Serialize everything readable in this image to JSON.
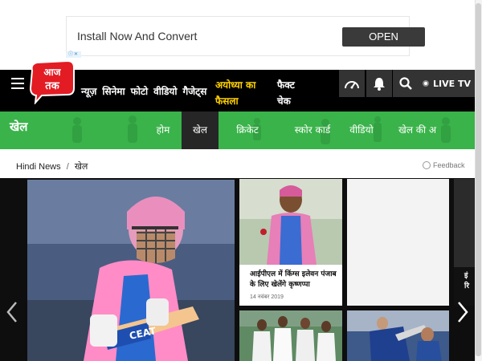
{
  "ad": {
    "text": "Install Now And Convert",
    "button_label": "OPEN",
    "ad_marker": "ⓘ✕"
  },
  "header": {
    "logo_text": "आज तक",
    "nav_items": [
      "न्यूज़",
      "सिनेमा",
      "फोटो",
      "वीडियो",
      "गैजेट्स"
    ],
    "highlight_line1": "अयोध्या का",
    "highlight_line2": "फैसला",
    "fact_line1": "फैक्ट",
    "fact_line2": "चेक",
    "live_label": "LIVE TV",
    "icons": [
      "speedometer-icon",
      "bell-icon",
      "search-icon"
    ]
  },
  "section": {
    "title": "खेल",
    "tabs": [
      "होम",
      "खेल",
      "क्रिकेट",
      "स्कोर कार्ड",
      "वीडियो",
      "खेल की अ"
    ],
    "active_tab": "खेल"
  },
  "breadcrumb": {
    "home": "Hindi News",
    "separator": "/",
    "current": "खेल"
  },
  "feedback_label": "Feedback",
  "cards": [
    {
      "title": "आईपीएल में किंग्स इलेवन पंजाब के लिए खेलेंगे कृष्णप्पा",
      "date": "14 नवंबर 2019"
    }
  ],
  "side_text": [
    "इं",
    "रि"
  ],
  "colors": {
    "accent_green": "#3ab34a",
    "header_black": "#000000",
    "highlight_yellow": "#ffd200",
    "logo_red": "#e31b23"
  }
}
